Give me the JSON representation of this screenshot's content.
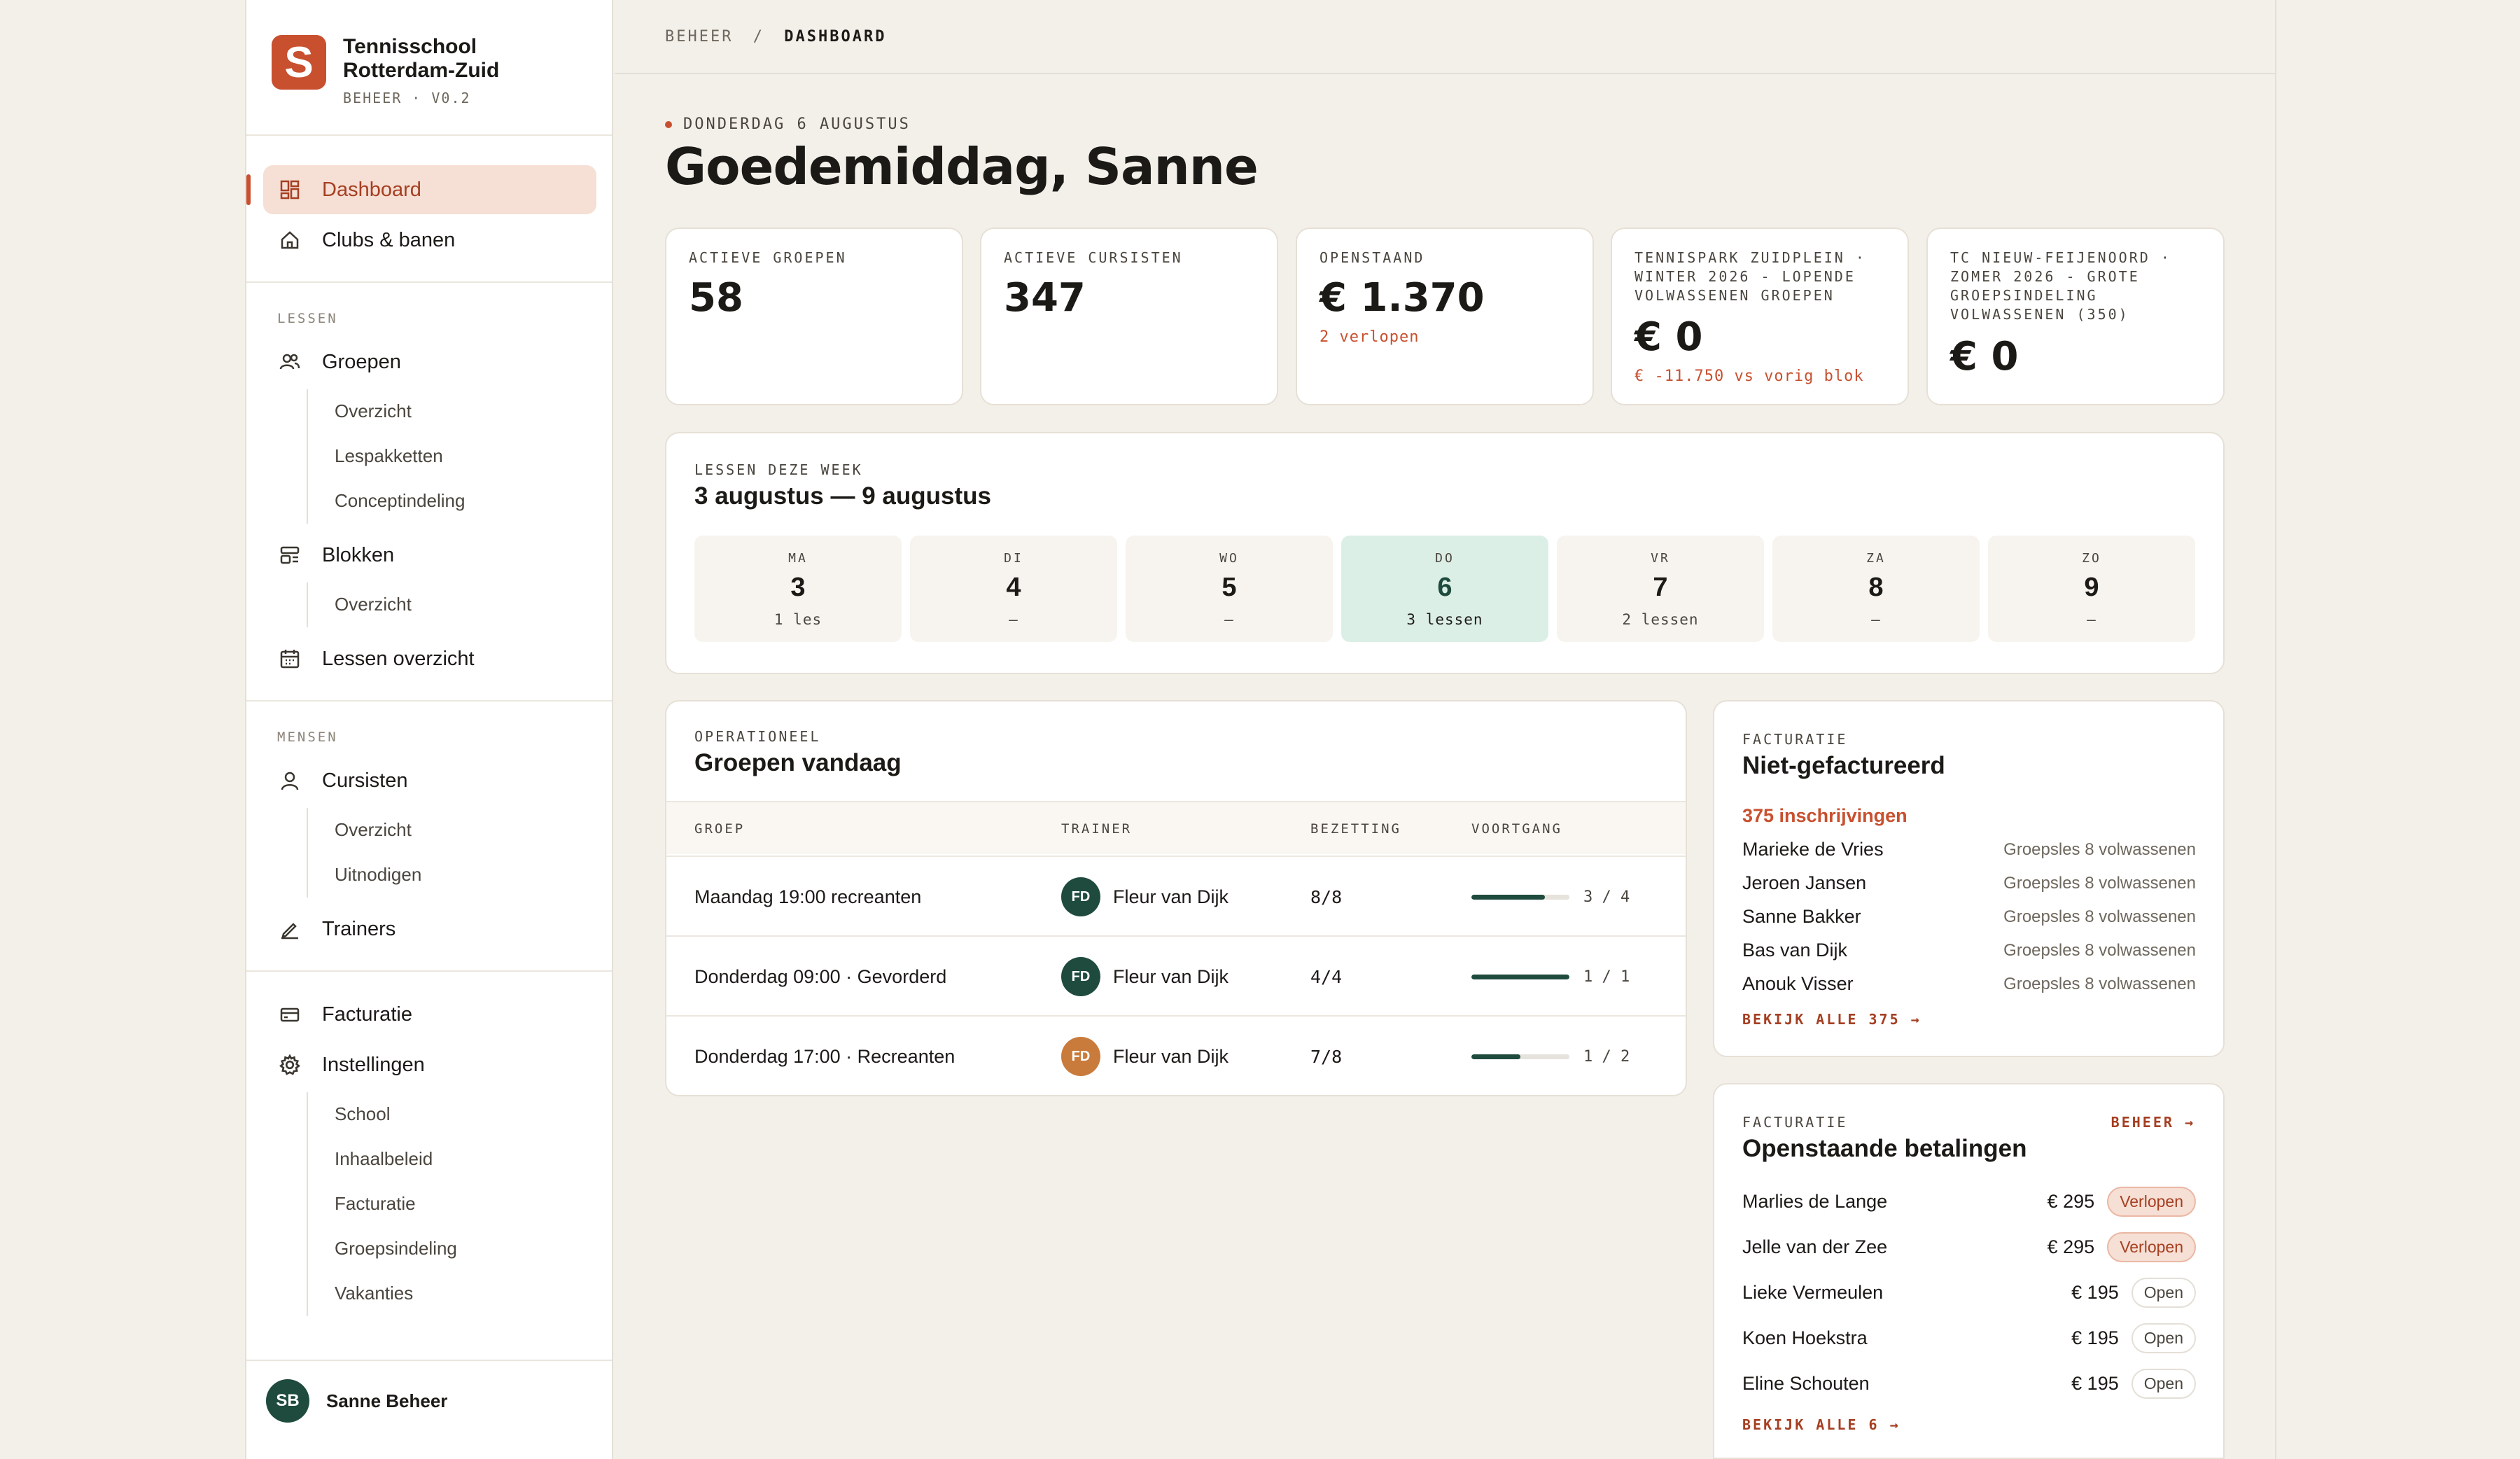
{
  "brand": {
    "logo_letter": "S",
    "name_line1": "Tennisschool",
    "name_line2": "Rotterdam-Zuid",
    "sub": "BEHEER · V0.2",
    "color": "#c8502f"
  },
  "nav": {
    "dashboard": "Dashboard",
    "clubs": "Clubs & banen",
    "section_lessen": "LESSEN",
    "groepen": "Groepen",
    "groepen_sub": [
      "Overzicht",
      "Lespakketten",
      "Conceptindeling"
    ],
    "blokken": "Blokken",
    "blokken_sub": [
      "Overzicht"
    ],
    "lessen_overzicht": "Lessen overzicht",
    "section_mensen": "MENSEN",
    "cursisten": "Cursisten",
    "cursisten_sub": [
      "Overzicht",
      "Uitnodigen"
    ],
    "trainers": "Trainers",
    "facturatie": "Facturatie",
    "instellingen": "Instellingen",
    "instellingen_sub": [
      "School",
      "Inhaalbeleid",
      "Facturatie",
      "Groepsindeling",
      "Vakanties"
    ]
  },
  "user": {
    "initials": "SB",
    "name": "Sanne Beheer"
  },
  "breadcrumb": {
    "parent": "BEHEER",
    "sep": "/",
    "current": "DASHBOARD"
  },
  "header": {
    "date": "DONDERDAG 6 AUGUSTUS",
    "greeting": "Goedemiddag, Sanne"
  },
  "kpis": [
    {
      "label": "ACTIEVE GROEPEN",
      "value": "58",
      "note": ""
    },
    {
      "label": "ACTIEVE CURSISTEN",
      "value": "347",
      "note": ""
    },
    {
      "label": "OPENSTAAND",
      "value": "€ 1.370",
      "note": "2 verlopen"
    },
    {
      "label": "TENNISPARK ZUIDPLEIN · WINTER 2026 - LOPENDE VOLWASSENEN GROEPEN",
      "value": "€ 0",
      "note": "€ -11.750 vs vorig blok"
    },
    {
      "label": "TC NIEUW-FEIJENOORD · ZOMER 2026 - GROTE GROEPSINDELING VOLWASSENEN (350)",
      "value": "€ 0",
      "note": ""
    }
  ],
  "week": {
    "label": "LESSEN DEZE WEEK",
    "title": "3 augustus — 9 augustus",
    "days": [
      {
        "name": "MA",
        "num": "3",
        "lessons": "1 les"
      },
      {
        "name": "DI",
        "num": "4",
        "lessons": "—"
      },
      {
        "name": "WO",
        "num": "5",
        "lessons": "—"
      },
      {
        "name": "DO",
        "num": "6",
        "lessons": "3 lessen"
      },
      {
        "name": "VR",
        "num": "7",
        "lessons": "2 lessen"
      },
      {
        "name": "ZA",
        "num": "8",
        "lessons": "—"
      },
      {
        "name": "ZO",
        "num": "9",
        "lessons": "—"
      }
    ]
  },
  "today_groups": {
    "label": "OPERATIONEEL",
    "title": "Groepen vandaag",
    "headers": [
      "GROEP",
      "TRAINER",
      "BEZETTING",
      "VOORTGANG"
    ],
    "rows": [
      {
        "group": "Maandag 19:00 recreanten",
        "trainer_initials": "FD",
        "trainer": "Fleur van Dijk",
        "avatar_color": "#1e4b3d",
        "occupancy": "8/8",
        "progress": 0.75,
        "progress_text": "3 / 4"
      },
      {
        "group": "Donderdag 09:00 · Gevorderd",
        "trainer_initials": "FD",
        "trainer": "Fleur van Dijk",
        "avatar_color": "#1e4b3d",
        "occupancy": "4/4",
        "progress": 1.0,
        "progress_text": "1 / 1"
      },
      {
        "group": "Donderdag 17:00 · Recreanten",
        "trainer_initials": "FD",
        "trainer": "Fleur van Dijk",
        "avatar_color": "#c97b3c",
        "occupancy": "7/8",
        "progress": 0.5,
        "progress_text": "1 / 2"
      }
    ]
  },
  "unbilled": {
    "label": "FACTURATIE",
    "title": "Niet-gefactureerd",
    "count": "375 inschrijvingen",
    "rows": [
      {
        "name": "Marieke de Vries",
        "item": "Groepsles 8 volwassenen"
      },
      {
        "name": "Jeroen Jansen",
        "item": "Groepsles 8 volwassenen"
      },
      {
        "name": "Sanne Bakker",
        "item": "Groepsles 8 volwassenen"
      },
      {
        "name": "Bas van Dijk",
        "item": "Groepsles 8 volwassenen"
      },
      {
        "name": "Anouk Visser",
        "item": "Groepsles 8 volwassenen"
      }
    ],
    "link": "BEKIJK ALLE 375 →"
  },
  "payments": {
    "label": "FACTURATIE",
    "manage": "BEHEER →",
    "title": "Openstaande betalingen",
    "rows": [
      {
        "name": "Marlies de Lange",
        "amount": "€ 295",
        "status": "Verlopen",
        "overdue": true
      },
      {
        "name": "Jelle van der Zee",
        "amount": "€ 295",
        "status": "Verlopen",
        "overdue": true
      },
      {
        "name": "Lieke Vermeulen",
        "amount": "€ 195",
        "status": "Open",
        "overdue": false
      },
      {
        "name": "Koen Hoekstra",
        "amount": "€ 195",
        "status": "Open",
        "overdue": false
      },
      {
        "name": "Eline Schouten",
        "amount": "€ 195",
        "status": "Open",
        "overdue": false
      }
    ],
    "link": "BEKIJK ALLE 6 →"
  }
}
